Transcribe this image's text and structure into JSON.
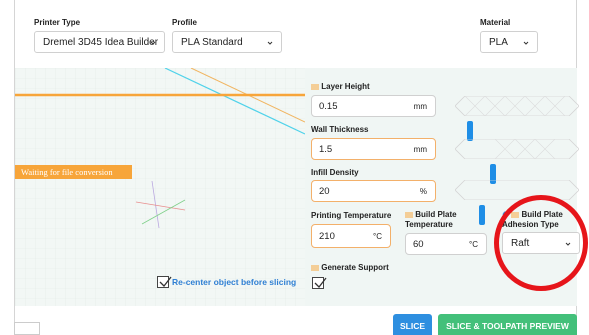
{
  "header": {
    "printer_type": {
      "label": "Printer Type",
      "value": "Dremel 3D45 Idea Builder"
    },
    "profile": {
      "label": "Profile",
      "value": "PLA Standard"
    },
    "material": {
      "label": "Material",
      "value": "PLA"
    }
  },
  "viewport": {
    "warning": "Waiting for file conversion",
    "recenter_label": "Re-center object before slicing",
    "recenter_checked": true
  },
  "settings": {
    "layer_height": {
      "label": "Layer Height",
      "value": "0.15",
      "unit": "mm",
      "slider_fraction": 0.1
    },
    "wall_thickness": {
      "label": "Wall Thickness",
      "value": "1.5",
      "unit": "mm",
      "slider_fraction": 0.3
    },
    "infill_density": {
      "label": "Infill Density",
      "value": "20",
      "unit": "%",
      "slider_fraction": 0.2
    },
    "printing_temperature": {
      "label": "Printing Temperature",
      "value": "210",
      "unit": "°C"
    },
    "build_plate_temperature": {
      "label": "Build Plate Temperature",
      "value": "60",
      "unit": "°C"
    },
    "build_plate_adhesion": {
      "label": "Build Plate Adhesion Type",
      "value": "Raft"
    },
    "generate_support": {
      "label": "Generate Support",
      "checked": true
    }
  },
  "actions": {
    "slice": "SLICE",
    "slice_preview": "SLICE & TOOLPATH PREVIEW"
  },
  "colors": {
    "accent_orange": "#f7a53a",
    "primary_blue": "#2e8fe0",
    "success_green": "#43c07a",
    "annotation_red": "#e6151a"
  }
}
